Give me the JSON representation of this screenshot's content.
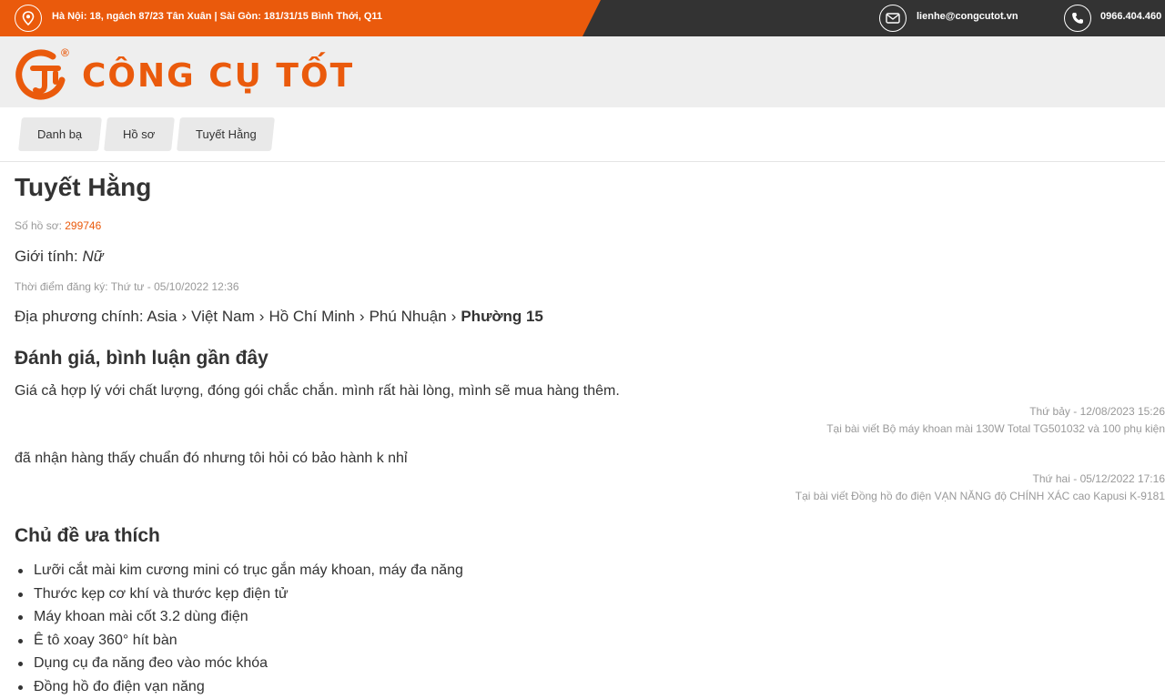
{
  "topbar": {
    "address": "Hà Nội: 18, ngách 87/23 Tân Xuân | Sài Gòn: 181/31/15 Bình Thới, Q11",
    "email": "lienhe@congcutot.vn",
    "phone": "0966.404.460",
    "icons": [
      "location-pin-icon",
      "mail-icon",
      "phone-icon"
    ],
    "colors": {
      "accent": "#ea5a0c",
      "dark": "#333333"
    }
  },
  "logo": {
    "text": "CÔNG CỤ TỐT",
    "registered": "®"
  },
  "breadcrumb": [
    "Danh bạ",
    "Hồ sơ",
    "Tuyết Hằng"
  ],
  "profile": {
    "name": "Tuyết Hằng",
    "profile_no_label": "Số hồ sơ: ",
    "profile_no": "299746",
    "gender_label": "Giới tính: ",
    "gender": "Nữ",
    "registered": "Thời điểm đăng ký: Thứ tư - 05/10/2022 12:36",
    "location_label": "Địa phương chính: ",
    "location_path": [
      "Asia",
      "Việt Nam",
      "Hồ Chí Minh",
      "Phú Nhuận"
    ],
    "location_current": "Phường 15"
  },
  "reviews": {
    "title": "Đánh giá, bình luận gần đây",
    "items": [
      {
        "text": "Giá cả hợp lý với chất lượng, đóng gói chắc chắn. mình rất hài lòng, mình sẽ mua hàng thêm.",
        "date": "Thứ bảy - 12/08/2023 15:26",
        "source": "Tại bài viết Bộ máy khoan mài 130W Total TG501032 và 100 phụ kiện"
      },
      {
        "text": "đã nhận hàng thấy chuẩn đó nhưng tôi hỏi có bảo hành k nhỉ",
        "date": "Thứ hai - 05/12/2022 17:16",
        "source": "Tại bài viết Đồng hồ đo điện VẠN NĂNG độ CHÍNH XÁC cao Kapusi K-9181"
      }
    ]
  },
  "topics": {
    "title": "Chủ đề ưa thích",
    "items": [
      "Lưỡi cắt mài kim cương mini có trục gắn máy khoan, máy đa năng",
      "Thước kẹp cơ khí và thước kẹp điện tử",
      "Máy khoan mài cốt 3.2 dùng điện",
      "Ê tô xoay 360° hít bàn",
      "Dụng cụ đa năng đeo vào móc khóa",
      "Đồng hồ đo điện vạn năng"
    ]
  }
}
